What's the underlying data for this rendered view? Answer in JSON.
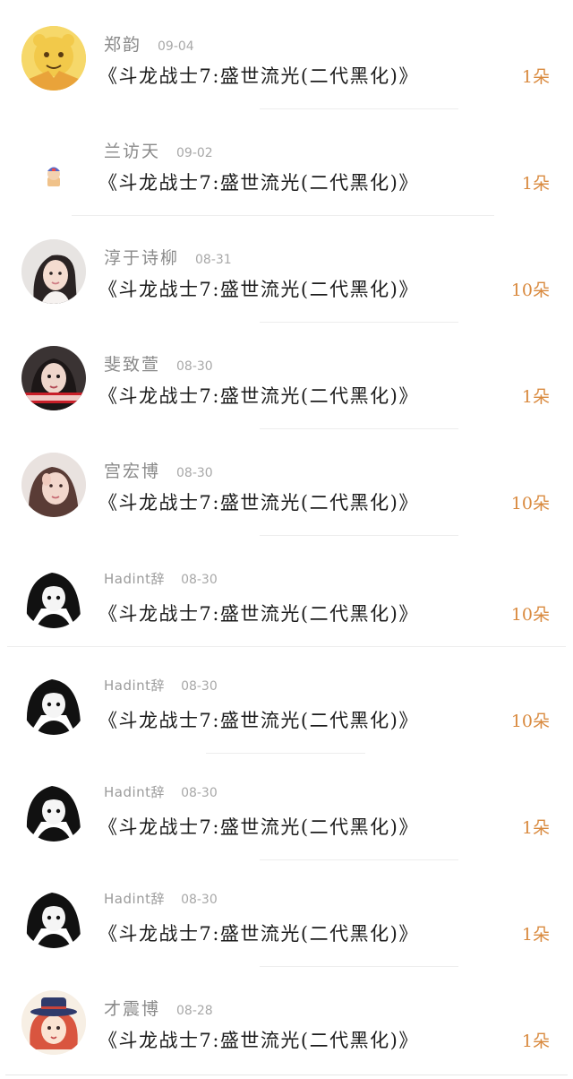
{
  "colors": {
    "name": "#8a8a8a",
    "date": "#a8a8a8",
    "gift": "#1c1c1c",
    "count": "#d98a3f",
    "divider": "#ededed"
  },
  "rows": [
    {
      "avatar": "cartoon-bear-avatar",
      "name": "郑韵",
      "date": "09-04",
      "gift": "《斗龙战士7:盛世流光(二代黑化)》",
      "count": "1朵"
    },
    {
      "avatar": "small-sticker-avatar",
      "name": "兰访天",
      "date": "09-02",
      "gift": "《斗龙战士7:盛世流光(二代黑化)》",
      "count": "1朵"
    },
    {
      "avatar": "girl-photo-avatar",
      "name": "淳于诗柳",
      "date": "08-31",
      "gift": "《斗龙战士7:盛世流光(二代黑化)》",
      "count": "10朵"
    },
    {
      "avatar": "woman-photo-avatar",
      "name": "斐致萱",
      "date": "08-30",
      "gift": "《斗龙战士7:盛世流光(二代黑化)》",
      "count": "1朵"
    },
    {
      "avatar": "woman-selfie-avatar",
      "name": "宫宏博",
      "date": "08-30",
      "gift": "《斗龙战士7:盛世流光(二代黑化)》",
      "count": "10朵"
    },
    {
      "avatar": "dark-anime-girl-avatar",
      "name": "Hadint辞",
      "date": "08-30",
      "gift": "《斗龙战士7:盛世流光(二代黑化)》",
      "count": "10朵"
    },
    {
      "avatar": "dark-anime-girl-avatar",
      "name": "Hadint辞",
      "date": "08-30",
      "gift": "《斗龙战士7:盛世流光(二代黑化)》",
      "count": "10朵"
    },
    {
      "avatar": "dark-anime-girl-avatar",
      "name": "Hadint辞",
      "date": "08-30",
      "gift": "《斗龙战士7:盛世流光(二代黑化)》",
      "count": "1朵"
    },
    {
      "avatar": "dark-anime-girl-avatar",
      "name": "Hadint辞",
      "date": "08-30",
      "gift": "《斗龙战士7:盛世流光(二代黑化)》",
      "count": "1朵"
    },
    {
      "avatar": "redhead-hat-girl-avatar",
      "name": "才震博",
      "date": "08-28",
      "gift": "《斗龙战士7:盛世流光(二代黑化)》",
      "count": "1朵"
    }
  ]
}
